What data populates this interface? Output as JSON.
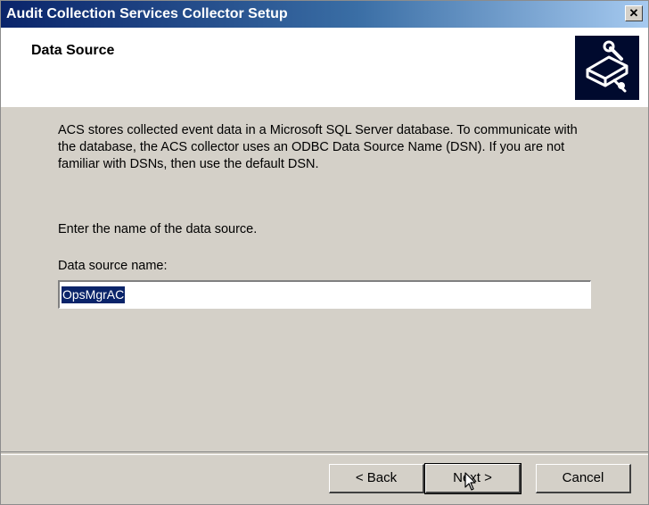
{
  "window": {
    "title": "Audit Collection Services Collector Setup",
    "close_glyph": "✕"
  },
  "header": {
    "title": "Data Source",
    "logo_icon": "setup-wizard-icon"
  },
  "body": {
    "description": "ACS stores collected event data in a Microsoft SQL Server database. To communicate with the database, the ACS collector uses an ODBC Data Source Name (DSN).  If you are not familiar with DSNs, then use the default DSN.",
    "prompt": "Enter the name of the data source.",
    "data_source_label": "Data source name:",
    "data_source_value": "OpsMgrAC"
  },
  "footer": {
    "back_label": "< Back",
    "next_label": "Next >",
    "cancel_label": "Cancel"
  },
  "colors": {
    "title_gradient_start": "#0a246a",
    "dialog_face": "#d4d0c8",
    "selection": "#0a246a"
  }
}
